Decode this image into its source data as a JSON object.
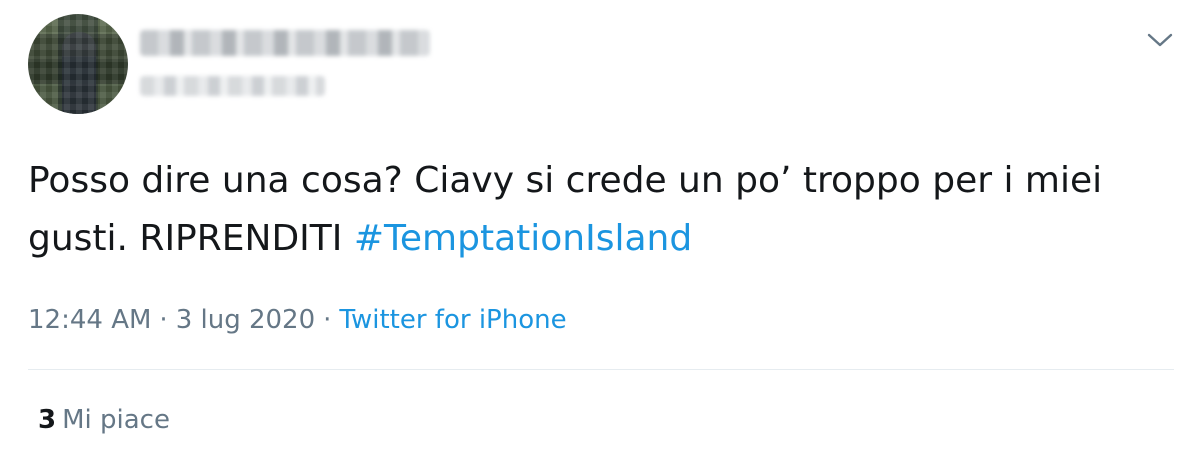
{
  "tweet": {
    "text_plain": "Posso dire una cosa? Ciavy si crede un po’ troppo per i miei gusti. RIPRENDITI ",
    "hashtag": "#TemptationIsland",
    "time": "12:44 AM",
    "separator": "·",
    "date": "3 lug 2020",
    "source": "Twitter for iPhone",
    "likes_count": "3",
    "likes_label": "Mi piace"
  },
  "icons": {
    "menu": "chevron-down-icon"
  },
  "colors": {
    "link": "#1b95e0",
    "text": "#14171a",
    "secondary": "#657786",
    "divider": "#e6ecf0"
  }
}
